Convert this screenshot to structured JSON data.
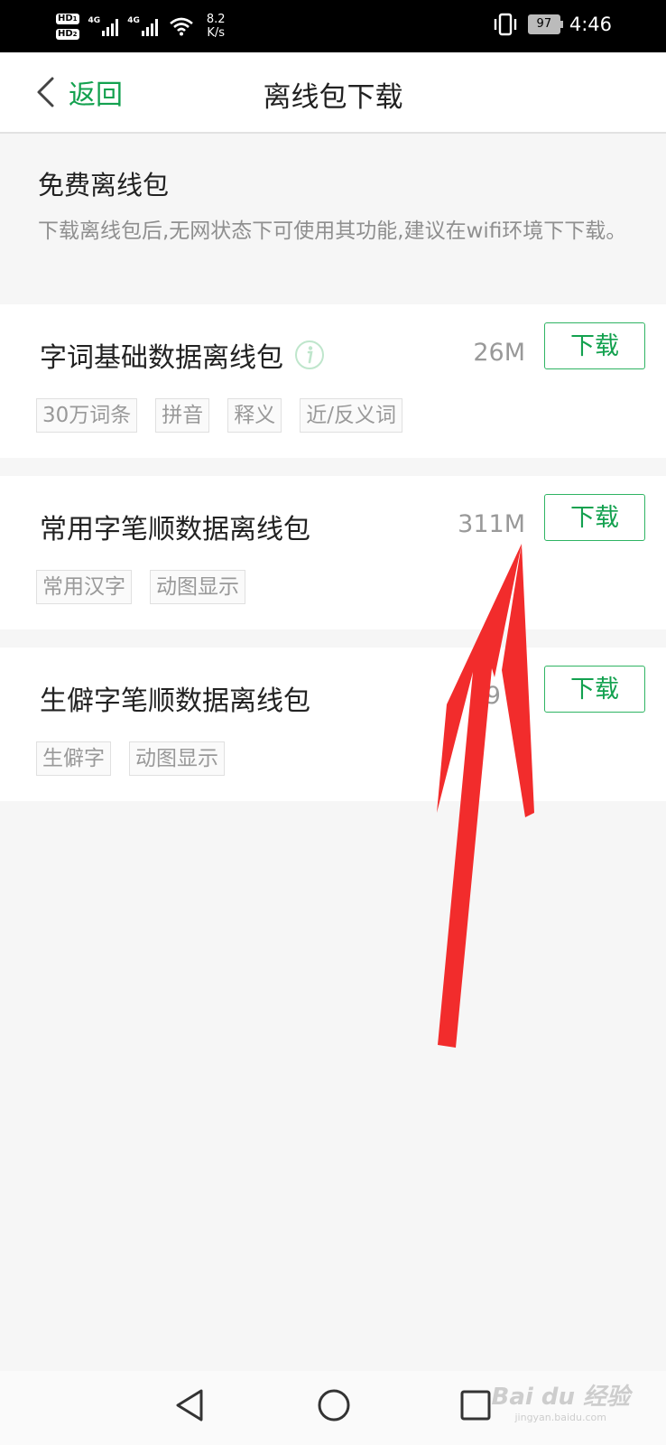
{
  "status_bar": {
    "sim1": "HD",
    "sim1_index": "1",
    "sim2": "HD",
    "sim2_index": "2",
    "network1": "4G",
    "network2": "4G",
    "speed_value": "8.2",
    "speed_unit": "K/s",
    "battery": "97",
    "time": "4:46"
  },
  "header": {
    "back_label": "返回",
    "title": "离线包下载"
  },
  "intro": {
    "title": "免费离线包",
    "description": "下载离线包后,无网状态下可使用其功能,建议在wifi环境下下载。"
  },
  "packages": [
    {
      "name": "字词基础数据离线包",
      "size": "26M",
      "button": "下载",
      "tags": [
        "30万词条",
        "拼音",
        "释义",
        "近/反义词"
      ]
    },
    {
      "name": "常用字笔顺数据离线包",
      "size": "311M",
      "button": "下载",
      "tags": [
        "常用汉字",
        "动图显示"
      ]
    },
    {
      "name": "生僻字笔顺数据离线包",
      "size": "9 V",
      "button": "下载",
      "tags": [
        "生僻字",
        "动图显示"
      ]
    }
  ],
  "watermark": {
    "brand": "Bai du 经验",
    "url": "jingyan.baidu.com"
  },
  "colors": {
    "accent": "#13a14f",
    "annotation_arrow": "#f22c2c"
  }
}
